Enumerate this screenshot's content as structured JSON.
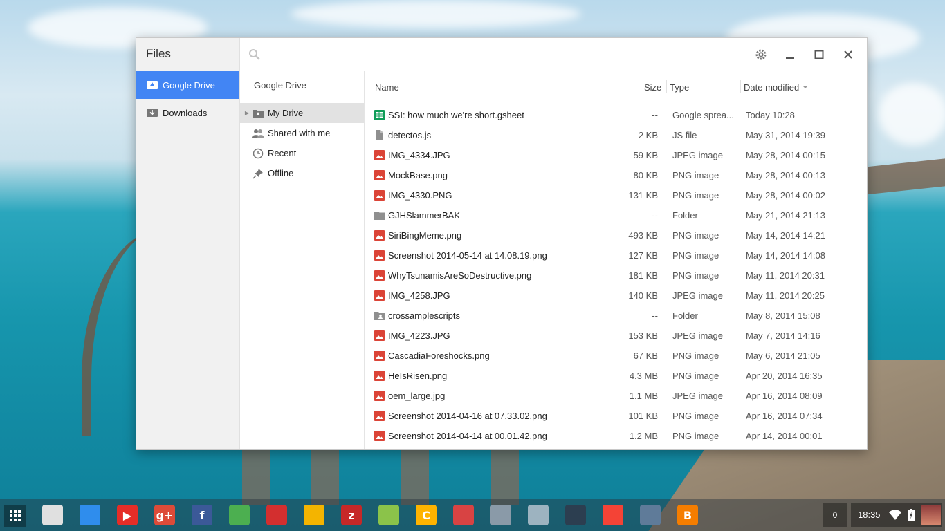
{
  "app": {
    "title": "Files"
  },
  "roots": [
    {
      "label": "Google Drive",
      "icon": "google-drive-icon",
      "active": true
    },
    {
      "label": "Downloads",
      "icon": "downloads-icon",
      "active": false
    }
  ],
  "search": {
    "placeholder": ""
  },
  "nav": {
    "header": "Google Drive",
    "items": [
      {
        "label": "My Drive",
        "icon": "drive-folder-icon",
        "selected": true
      },
      {
        "label": "Shared with me",
        "icon": "shared-people-icon",
        "selected": false
      },
      {
        "label": "Recent",
        "icon": "clock-icon",
        "selected": false
      },
      {
        "label": "Offline",
        "icon": "pin-icon",
        "selected": false
      }
    ]
  },
  "columns": {
    "name": "Name",
    "size": "Size",
    "type": "Type",
    "date": "Date modified"
  },
  "files": [
    {
      "name": "SSI: how much we're short.gsheet",
      "size": "--",
      "type": "Google sprea...",
      "date": "Today 10:28",
      "kind": "sheet"
    },
    {
      "name": "detectos.js",
      "size": "2 KB",
      "type": "JS file",
      "date": "May 31, 2014 19:39",
      "kind": "file"
    },
    {
      "name": "IMG_4334.JPG",
      "size": "59 KB",
      "type": "JPEG image",
      "date": "May 28, 2014 00:15",
      "kind": "image"
    },
    {
      "name": "MockBase.png",
      "size": "80 KB",
      "type": "PNG image",
      "date": "May 28, 2014 00:13",
      "kind": "image"
    },
    {
      "name": "IMG_4330.PNG",
      "size": "131 KB",
      "type": "PNG image",
      "date": "May 28, 2014 00:02",
      "kind": "image"
    },
    {
      "name": "GJHSlammerBAK",
      "size": "--",
      "type": "Folder",
      "date": "May 21, 2014 21:13",
      "kind": "folder"
    },
    {
      "name": "SiriBingMeme.png",
      "size": "493 KB",
      "type": "PNG image",
      "date": "May 14, 2014 14:21",
      "kind": "image"
    },
    {
      "name": "Screenshot 2014-05-14 at 14.08.19.png",
      "size": "127 KB",
      "type": "PNG image",
      "date": "May 14, 2014 14:08",
      "kind": "image"
    },
    {
      "name": "WhyTsunamisAreSoDestructive.png",
      "size": "181 KB",
      "type": "PNG image",
      "date": "May 11, 2014 20:31",
      "kind": "image"
    },
    {
      "name": "IMG_4258.JPG",
      "size": "140 KB",
      "type": "JPEG image",
      "date": "May 11, 2014 20:25",
      "kind": "image"
    },
    {
      "name": "crossamplescripts",
      "size": "--",
      "type": "Folder",
      "date": "May 8, 2014 15:08",
      "kind": "shared-folder"
    },
    {
      "name": "IMG_4223.JPG",
      "size": "153 KB",
      "type": "JPEG image",
      "date": "May 7, 2014 14:16",
      "kind": "image"
    },
    {
      "name": "CascadiaForeshocks.png",
      "size": "67 KB",
      "type": "PNG image",
      "date": "May 6, 2014 21:05",
      "kind": "image"
    },
    {
      "name": "HeIsRisen.png",
      "size": "4.3 MB",
      "type": "PNG image",
      "date": "Apr 20, 2014 16:35",
      "kind": "image"
    },
    {
      "name": "oem_large.jpg",
      "size": "1.1 MB",
      "type": "JPEG image",
      "date": "Apr 16, 2014 08:09",
      "kind": "image"
    },
    {
      "name": "Screenshot 2014-04-16 at 07.33.02.png",
      "size": "101 KB",
      "type": "PNG image",
      "date": "Apr 16, 2014 07:34",
      "kind": "image"
    },
    {
      "name": "Screenshot 2014-04-14 at 00.01.42.png",
      "size": "1.2 MB",
      "type": "PNG image",
      "date": "Apr 14, 2014 00:01",
      "kind": "image"
    }
  ],
  "shelf": {
    "apps": [
      {
        "name": "web-store-icon",
        "color": "#e0e0e0",
        "glyph": ""
      },
      {
        "name": "files-app-icon",
        "color": "#2f8ded",
        "glyph": ""
      },
      {
        "name": "youtube-icon",
        "color": "#e52d27",
        "glyph": "▶"
      },
      {
        "name": "google-plus-icon",
        "color": "#dd4b39",
        "glyph": "g+"
      },
      {
        "name": "facebook-icon",
        "color": "#3b5998",
        "glyph": "f"
      },
      {
        "name": "chrome-icon",
        "color": "#4caf50",
        "glyph": ""
      },
      {
        "name": "play-movies-icon",
        "color": "#d32f2f",
        "glyph": ""
      },
      {
        "name": "play-music-icon",
        "color": "#f4b400",
        "glyph": ""
      },
      {
        "name": "sleep-blocker-icon",
        "color": "#c62828",
        "glyph": "z"
      },
      {
        "name": "google-maps-icon",
        "color": "#8bc34a",
        "glyph": ""
      },
      {
        "name": "c-app-icon",
        "color": "#ffb300",
        "glyph": "C"
      },
      {
        "name": "toolbox-icon",
        "color": "#d84343",
        "glyph": ""
      },
      {
        "name": "box-app-icon",
        "color": "#8a9aa8",
        "glyph": ""
      },
      {
        "name": "cube-app-icon",
        "color": "#9db3c0",
        "glyph": ""
      },
      {
        "name": "waveform-app-icon",
        "color": "#2c3e50",
        "glyph": ""
      },
      {
        "name": "sunset-app-icon",
        "color": "#f44336",
        "glyph": ""
      },
      {
        "name": "chrome-tools-icon",
        "color": "#5f7b99",
        "glyph": ""
      },
      {
        "name": "blogger-icon",
        "color": "#f57d00",
        "glyph": "B"
      }
    ],
    "notification_count": "0",
    "clock": "18:35"
  },
  "colors": {
    "accent": "#4285f4",
    "image_icon": "#db4437",
    "sheet_icon": "#0f9d58",
    "folder_icon": "#8f8f8f"
  }
}
